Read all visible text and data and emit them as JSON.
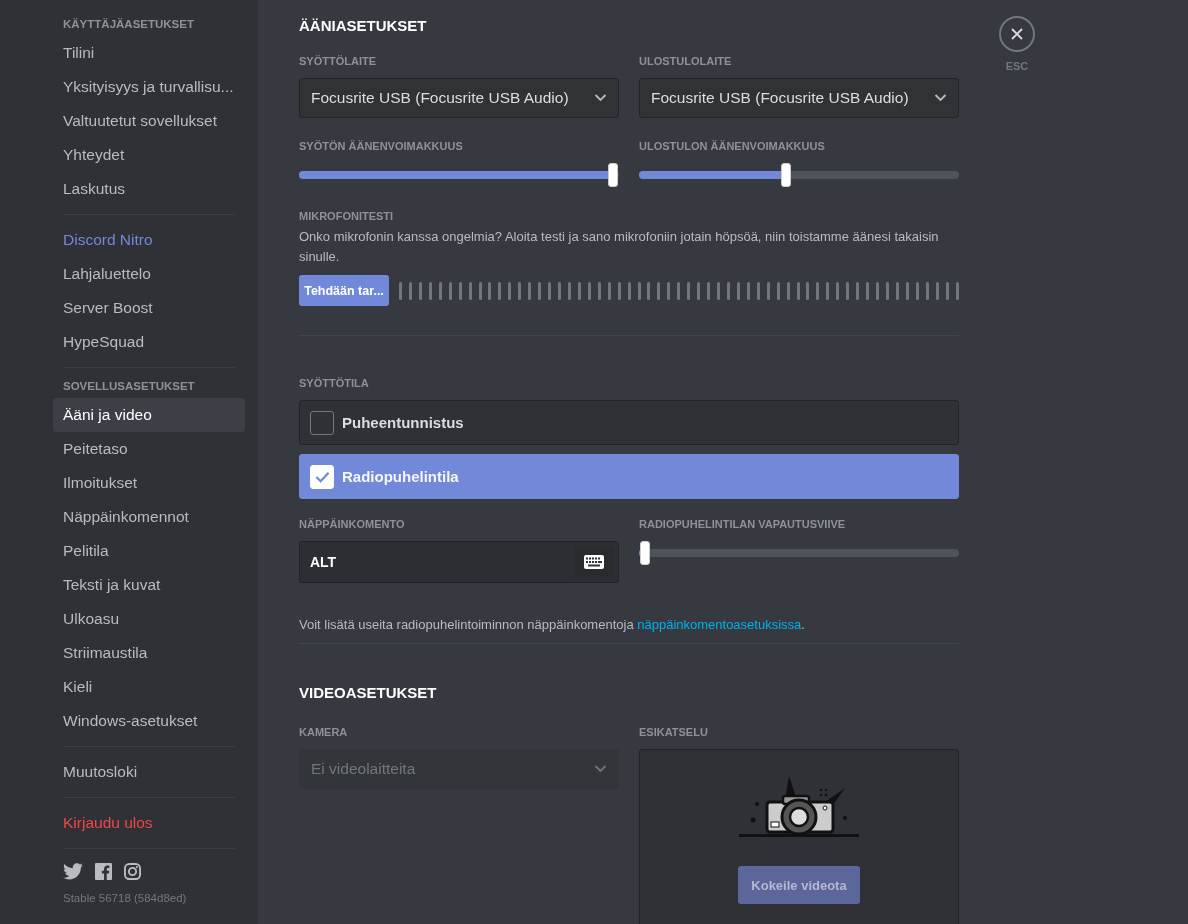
{
  "sidebar": {
    "groups": [
      {
        "header": "KÄYTTÄJÄASETUKSET",
        "items": [
          {
            "label": "Tilini",
            "kind": "normal",
            "selected": false
          },
          {
            "label": "Yksityisyys ja turvallisu...",
            "kind": "normal",
            "selected": false
          },
          {
            "label": "Valtuutetut sovellukset",
            "kind": "normal",
            "selected": false
          },
          {
            "label": "Yhteydet",
            "kind": "normal",
            "selected": false
          },
          {
            "label": "Laskutus",
            "kind": "normal",
            "selected": false
          }
        ]
      },
      {
        "items": [
          {
            "label": "Discord Nitro",
            "kind": "premium",
            "selected": false
          },
          {
            "label": "Lahjaluettelo",
            "kind": "normal",
            "selected": false
          },
          {
            "label": "Server Boost",
            "kind": "normal",
            "selected": false
          },
          {
            "label": "HypeSquad",
            "kind": "normal",
            "selected": false
          }
        ]
      },
      {
        "header": "SOVELLUSASETUKSET",
        "items": [
          {
            "label": "Ääni ja video",
            "kind": "normal",
            "selected": true
          },
          {
            "label": "Peitetaso",
            "kind": "normal",
            "selected": false
          },
          {
            "label": "Ilmoitukset",
            "kind": "normal",
            "selected": false
          },
          {
            "label": "Näppäinkomennot",
            "kind": "normal",
            "selected": false
          },
          {
            "label": "Pelitila",
            "kind": "normal",
            "selected": false
          },
          {
            "label": "Teksti ja kuvat",
            "kind": "normal",
            "selected": false
          },
          {
            "label": "Ulkoasu",
            "kind": "normal",
            "selected": false
          },
          {
            "label": "Striimaustila",
            "kind": "normal",
            "selected": false
          },
          {
            "label": "Kieli",
            "kind": "normal",
            "selected": false
          },
          {
            "label": "Windows-asetukset",
            "kind": "normal",
            "selected": false
          }
        ]
      },
      {
        "items": [
          {
            "label": "Muutosloki",
            "kind": "normal",
            "selected": false
          }
        ]
      },
      {
        "items": [
          {
            "label": "Kirjaudu ulos",
            "kind": "danger",
            "selected": false
          }
        ]
      }
    ],
    "version": "Stable 56718 (584d8ed)"
  },
  "close": {
    "label": "ESC"
  },
  "voice": {
    "title": "ÄÄNIASETUKSET",
    "input_device": {
      "label": "SYÖTTÖLAITE",
      "value": "Focusrite USB (Focusrite USB Audio)"
    },
    "output_device": {
      "label": "ULOSTULOLAITE",
      "value": "Focusrite USB (Focusrite USB Audio)"
    },
    "input_volume": {
      "label": "SYÖTÖN ÄÄNENVOIMAKKUUS",
      "level": 0.98
    },
    "output_volume": {
      "label": "ULOSTULON ÄÄNENVOIMAKKUUS",
      "level": 0.46
    },
    "mic_test": {
      "label": "MIKROFONITESTI",
      "description": "Onko mikrofonin kanssa ongelmia? Aloita testi ja sano mikrofoniin jotain höpsöä, niin toistamme äänesi takaisin sinulle.",
      "button": "Tehdään tar..."
    },
    "input_mode": {
      "label": "SYÖTTÖTILA",
      "options": [
        {
          "label": "Puheentunnistus",
          "selected": false
        },
        {
          "label": "Radiopuhelintila",
          "selected": true
        }
      ]
    },
    "shortcut": {
      "label": "NÄPPÄINKOMENTO",
      "value": "ALT"
    },
    "release_delay": {
      "label": "RADIOPUHELINTILAN VAPAUTUSVIIVE",
      "level": 0.02
    },
    "note": {
      "text": "Voit lisätä useita radiopuhelintoiminnon näppäinkomentoja ",
      "link": "näppäinkomentoasetuksissa",
      "end": "."
    }
  },
  "video": {
    "title": "VIDEOASETUKSET",
    "camera": {
      "label": "KAMERA",
      "value": "Ei videolaitteita",
      "disabled": true
    },
    "preview": {
      "label": "ESIKATSELU",
      "button": "Kokeile videota",
      "disabled": true
    }
  }
}
